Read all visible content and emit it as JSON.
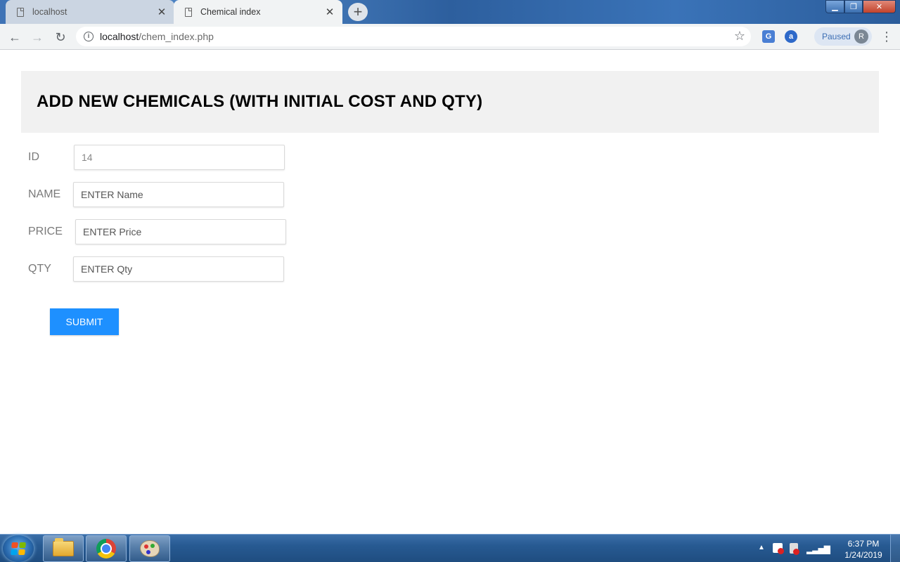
{
  "browser": {
    "tabs": [
      {
        "label": "localhost",
        "active": false
      },
      {
        "label": "Chemical index",
        "active": true
      }
    ],
    "new_tab_icon": "plus-icon",
    "url_host": "localhost",
    "url_path": "/chem_index.php",
    "profile_status": "Paused",
    "profile_initial": "R"
  },
  "page": {
    "heading": "ADD NEW CHEMICALS (WITH INITIAL COST AND QTY)",
    "fields": {
      "id": {
        "label": "ID",
        "value": "14"
      },
      "name": {
        "label": "NAME",
        "placeholder": "ENTER Name"
      },
      "price": {
        "label": "PRICE",
        "placeholder": "ENTER Price"
      },
      "qty": {
        "label": "QTY",
        "placeholder": "ENTER Qty"
      }
    },
    "submit_label": "SUBMIT"
  },
  "taskbar": {
    "time": "6:37 PM",
    "date": "1/24/2019",
    "pinned": [
      "folder-icon",
      "chrome-icon",
      "paint-icon"
    ]
  },
  "colors": {
    "submit_bg": "#1e90ff",
    "header_panel_bg": "#f1f1f1"
  }
}
